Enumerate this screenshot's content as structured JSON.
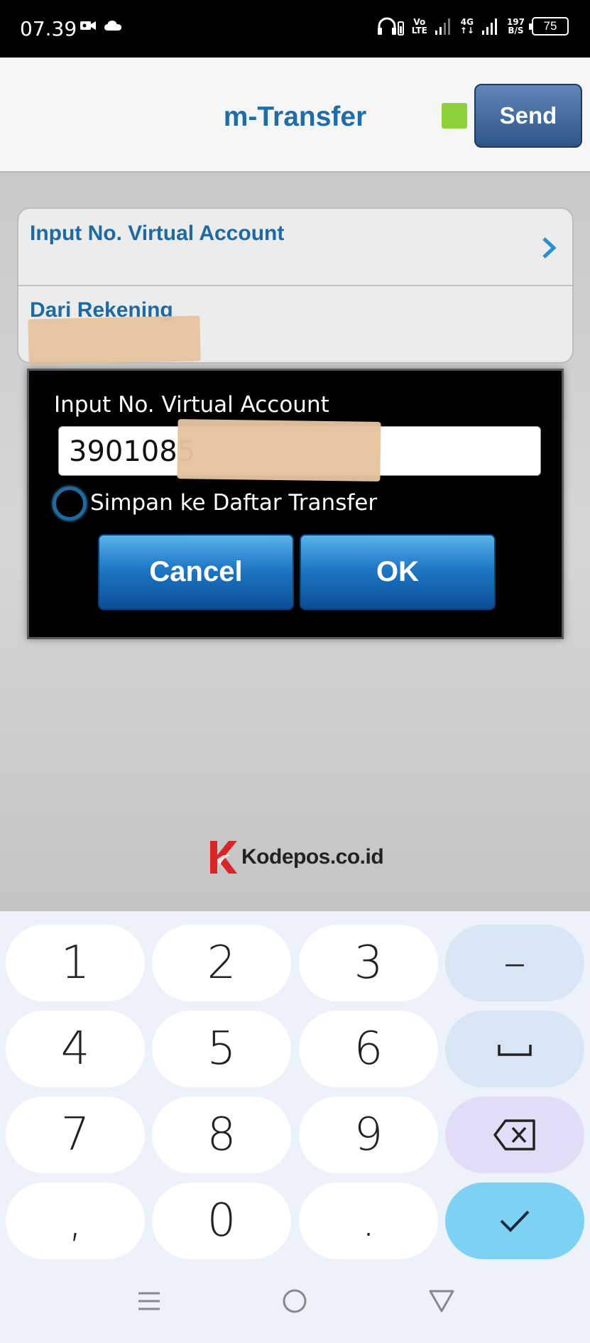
{
  "status_bar": {
    "time": "07.39",
    "net_top": "Vo",
    "net_bottom": "LTE",
    "sig_top": "4G",
    "sig_bottom": "↑↓",
    "speed_top": "197",
    "speed_bottom": "B/S",
    "battery": "75",
    "icons": [
      "video-camera-icon",
      "cloud-icon",
      "headphones-icon",
      "signal-icon",
      "signal-icon",
      "battery-icon"
    ]
  },
  "header": {
    "title": "m-Transfer",
    "send_label": "Send",
    "indicator_color": "#8bd13a"
  },
  "form": {
    "virtual_account_label": "Input No. Virtual Account",
    "from_account_label": "Dari Rekening"
  },
  "dialog": {
    "title": "Input No. Virtual Account",
    "input_value": "3901085",
    "save_label": "Simpan ke Daftar Transfer",
    "cancel_label": "Cancel",
    "ok_label": "OK"
  },
  "watermark": {
    "text": "Kodepos.co.id",
    "brand_color": "#d9252a"
  },
  "keyboard": {
    "keys": [
      "1",
      "2",
      "3",
      "–",
      "4",
      "5",
      "6",
      "space",
      "7",
      "8",
      "9",
      "backspace",
      ",",
      "0",
      ".",
      "enter"
    ]
  },
  "colors": {
    "accent_blue": "#1f6ca6",
    "button_blue": "#1e78c6",
    "enter_key": "#7dd1f5"
  }
}
